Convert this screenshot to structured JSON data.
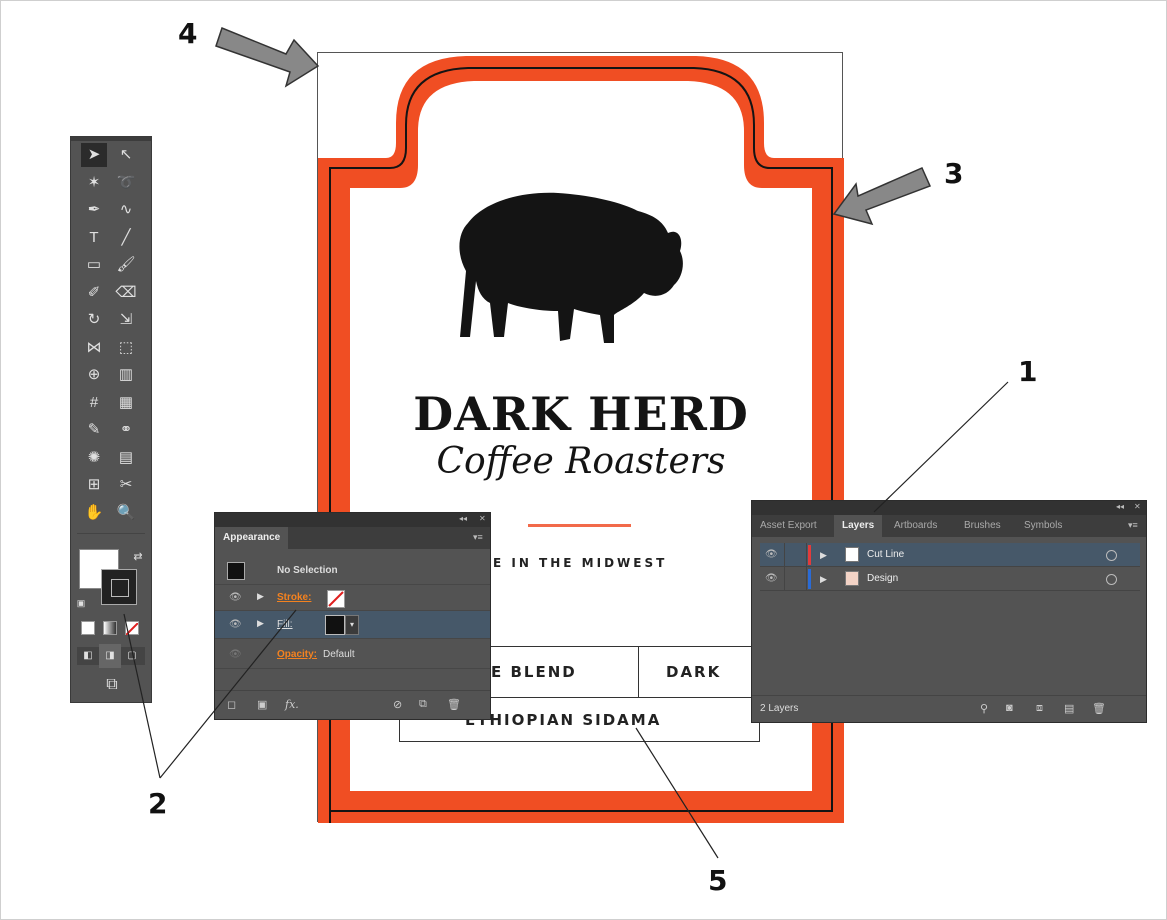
{
  "label": {
    "title": "DARK HERD",
    "subtitle": "Coffee Roasters",
    "tagline": "E IN THE MIDWEST",
    "blends": [
      "E BLEND",
      "DARK",
      "ETHIOPIAN SIDAMA"
    ],
    "colors": {
      "frame": "#f04e23",
      "ink": "#141414",
      "rule": "#f26a4a"
    }
  },
  "appearance": {
    "tab": "Appearance",
    "selection": "No Selection",
    "stroke_label": "Stroke:",
    "fill_label": "Fill:",
    "opacity_label": "Opacity:",
    "opacity_value": "Default",
    "fx_label": "fx."
  },
  "layers": {
    "tabs": [
      "Asset Export",
      "Layers",
      "Artboards",
      "Brushes",
      "Symbols"
    ],
    "active_tab": "Layers",
    "items": [
      {
        "name": "Cut Line",
        "color": "#e23b3b"
      },
      {
        "name": "Design",
        "color": "#2a6bd6"
      }
    ],
    "count": "2 Layers"
  },
  "tools": {
    "icons": [
      "selection-icon",
      "direct-selection-icon",
      "magic-wand-icon",
      "lasso-icon",
      "pen-icon",
      "curvature-icon",
      "type-icon",
      "line-icon",
      "rectangle-icon",
      "paintbrush-icon",
      "shaper-icon",
      "eraser-icon",
      "rotate-icon",
      "scale-icon",
      "width-icon",
      "free-transform-icon",
      "shape-builder-icon",
      "chart-icon",
      "mesh-icon",
      "gradient-icon",
      "eyedropper-icon",
      "blend-icon",
      "symbol-sprayer-icon",
      "column-graph-icon",
      "artboard-icon",
      "slice-icon",
      "hand-icon",
      "zoom-icon"
    ]
  },
  "callouts": [
    "1",
    "2",
    "3",
    "4",
    "5"
  ]
}
